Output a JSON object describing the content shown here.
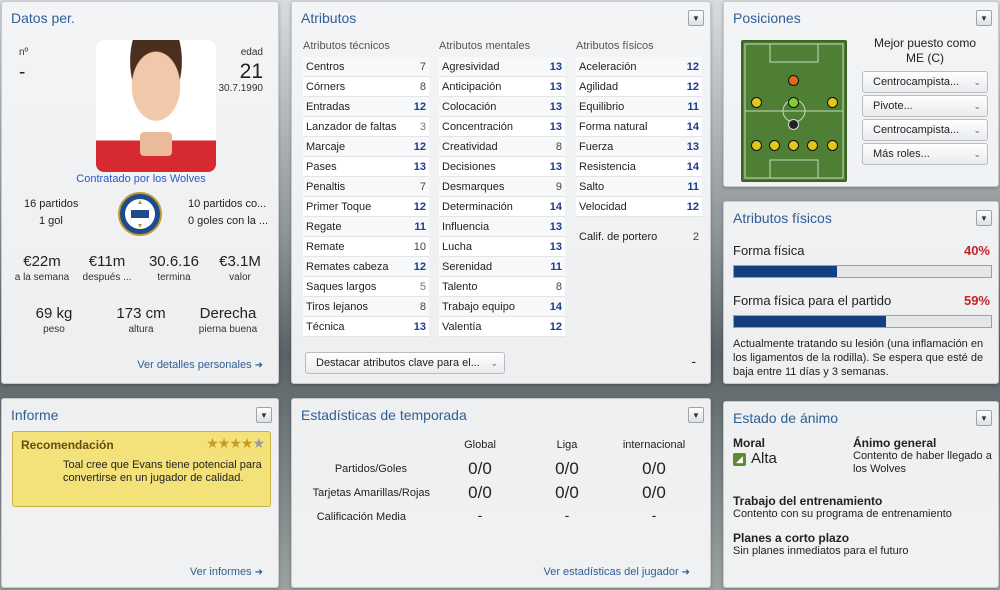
{
  "datos": {
    "title": "Datos per.",
    "num_label": "nº",
    "num_value": "-",
    "edad_label": "edad",
    "edad_value": "21",
    "birth": "30.7.1990",
    "contract": "Contratado por los Wolves",
    "partidos_left": "16 partidos",
    "goles_left": "1 gol",
    "partidos_right": "10 partidos co...",
    "goles_right": "0 goles con la ...",
    "stats": [
      {
        "value": "€22m",
        "label": "a la semana"
      },
      {
        "value": "€11m",
        "label": "después ..."
      },
      {
        "value": "30.6.16",
        "label": "termina"
      },
      {
        "value": "€3.1M",
        "label": "valor"
      }
    ],
    "body": [
      {
        "value": "69 kg",
        "label": "peso"
      },
      {
        "value": "173 cm",
        "label": "altura"
      },
      {
        "value": "Derecha",
        "label": "pierna buena"
      }
    ],
    "link": "Ver detalles personales"
  },
  "atributos": {
    "title": "Atributos",
    "tecnicos_head": "Atributos técnicos",
    "mentales_head": "Atributos mentales",
    "fisicos_head": "Atributos físicos",
    "tecnicos": [
      {
        "name": "Centros",
        "value": "7"
      },
      {
        "name": "Córners",
        "value": "8"
      },
      {
        "name": "Entradas",
        "value": "12"
      },
      {
        "name": "Lanzador de faltas",
        "value": "3"
      },
      {
        "name": "Marcaje",
        "value": "12"
      },
      {
        "name": "Pases",
        "value": "13"
      },
      {
        "name": "Penaltis",
        "value": "7"
      },
      {
        "name": "Primer Toque",
        "value": "12"
      },
      {
        "name": "Regate",
        "value": "11"
      },
      {
        "name": "Remate",
        "value": "10"
      },
      {
        "name": "Remates cabeza",
        "value": "12"
      },
      {
        "name": "Saques largos",
        "value": "5"
      },
      {
        "name": "Tiros lejanos",
        "value": "8"
      },
      {
        "name": "Técnica",
        "value": "13"
      }
    ],
    "mentales": [
      {
        "name": "Agresividad",
        "value": "13"
      },
      {
        "name": "Anticipación",
        "value": "13"
      },
      {
        "name": "Colocación",
        "value": "13"
      },
      {
        "name": "Concentración",
        "value": "13"
      },
      {
        "name": "Creatividad",
        "value": "8"
      },
      {
        "name": "Decisiones",
        "value": "13"
      },
      {
        "name": "Desmarques",
        "value": "9"
      },
      {
        "name": "Determinación",
        "value": "14"
      },
      {
        "name": "Influencia",
        "value": "13"
      },
      {
        "name": "Lucha",
        "value": "13"
      },
      {
        "name": "Serenidad",
        "value": "11"
      },
      {
        "name": "Talento",
        "value": "8"
      },
      {
        "name": "Trabajo equipo",
        "value": "14"
      },
      {
        "name": "Valentía",
        "value": "12"
      }
    ],
    "fisicos": [
      {
        "name": "Aceleración",
        "value": "12"
      },
      {
        "name": "Agilidad",
        "value": "12"
      },
      {
        "name": "Equilibrio",
        "value": "11"
      },
      {
        "name": "Forma natural",
        "value": "14"
      },
      {
        "name": "Fuerza",
        "value": "13"
      },
      {
        "name": "Resistencia",
        "value": "14"
      },
      {
        "name": "Salto",
        "value": "11"
      },
      {
        "name": "Velocidad",
        "value": "12"
      }
    ],
    "portero_label": "Calif. de portero",
    "portero_value": "2",
    "highlight_dropdown": "Destacar atributos clave para el...",
    "dash": "-"
  },
  "posiciones": {
    "title": "Posiciones",
    "best_label": "Mejor puesto como",
    "best_value": "ME (C)",
    "roles": [
      "Centrocampista...",
      "Pivote...",
      "Centrocampista...",
      "Más roles..."
    ]
  },
  "fisicos": {
    "title": "Atributos físicos",
    "forma_label": "Forma física",
    "forma_value": "40%",
    "forma_pct": 40,
    "partido_label": "Forma física para el partido",
    "partido_value": "59%",
    "partido_pct": 59,
    "injury": "Actualmente tratando su lesión (una inflamación en los ligamentos de la rodilla). Se espera que esté de baja entre 11 días y 3 semanas."
  },
  "informe": {
    "title": "Informe",
    "rec_title": "Recomendación",
    "stars": "★★★★★",
    "rec_text": "Toal cree que Evans tiene potencial para convertirse en un jugador de calidad.",
    "link": "Ver informes"
  },
  "temporada": {
    "title": "Estadísticas de temporada",
    "cols": [
      "Global",
      "Liga",
      "internacional"
    ],
    "rows": [
      {
        "label": "Partidos/Goles",
        "values": [
          "0/0",
          "0/0",
          "0/0"
        ]
      },
      {
        "label": "Tarjetas Amarillas/Rojas",
        "values": [
          "0/0",
          "0/0",
          "0/0"
        ]
      },
      {
        "label": "Calificación Media",
        "values": [
          "-",
          "-",
          "-"
        ]
      }
    ],
    "link": "Ver estadísticas del jugador"
  },
  "animo": {
    "title": "Estado de ánimo",
    "moral_label": "Moral",
    "moral_value": "Alta",
    "general_label": "Ánimo general",
    "general_value": "Contento de haber llegado a los Wolves",
    "entreno_label": "Trabajo del entrenamiento",
    "entreno_value": "Contento con su programa de entrenamiento",
    "planes_label": "Planes a corto plazo",
    "planes_value": "Sin planes inmediatos para el futuro"
  }
}
